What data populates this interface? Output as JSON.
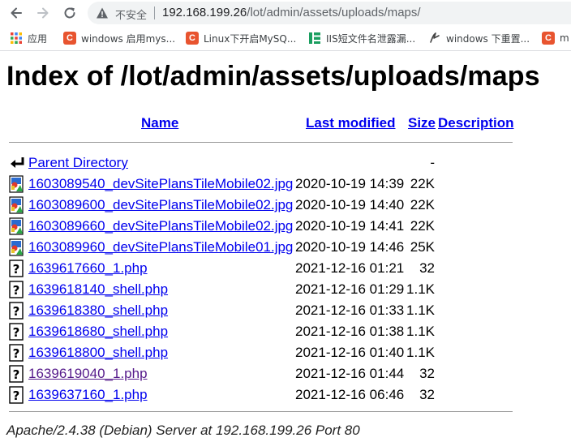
{
  "browser": {
    "security_label": "不安全",
    "url_host": "192.168.199.26",
    "url_path": "/lot/admin/assets/uploads/maps/"
  },
  "bookmarks": [
    {
      "label": "应用",
      "icon": "apps-grid-icon"
    },
    {
      "label": "windows 启用mys...",
      "icon": "csdn-icon"
    },
    {
      "label": "Linux下开启MySQ...",
      "icon": "csdn-icon"
    },
    {
      "label": "IIS短文件名泄露漏...",
      "icon": "page-icon"
    },
    {
      "label": "windows 下重置...",
      "icon": "link-icon"
    },
    {
      "label": "m",
      "icon": "csdn-icon"
    }
  ],
  "page": {
    "title": "Index of /lot/admin/assets/uploads/maps",
    "columns": {
      "name": "Name",
      "last_modified": "Last modified",
      "size": "Size",
      "description": "Description"
    },
    "parent": {
      "name": "Parent Directory",
      "size": "-",
      "icon": "back-arrow-icon"
    },
    "files": [
      {
        "name": "1603089540_devSitePlansTileMobile02.jpg",
        "modified": "2020-10-19 14:39",
        "size": "22K",
        "type": "image",
        "visited": false
      },
      {
        "name": "1603089600_devSitePlansTileMobile02.jpg",
        "modified": "2020-10-19 14:40",
        "size": "22K",
        "type": "image",
        "visited": false
      },
      {
        "name": "1603089660_devSitePlansTileMobile02.jpg",
        "modified": "2020-10-19 14:41",
        "size": "22K",
        "type": "image",
        "visited": false
      },
      {
        "name": "1603089960_devSitePlansTileMobile01.jpg",
        "modified": "2020-10-19 14:46",
        "size": "25K",
        "type": "image",
        "visited": false
      },
      {
        "name": "1639617660_1.php",
        "modified": "2021-12-16 01:21",
        "size": "32",
        "type": "unknown",
        "visited": false
      },
      {
        "name": "1639618140_shell.php",
        "modified": "2021-12-16 01:29",
        "size": "1.1K",
        "type": "unknown",
        "visited": false
      },
      {
        "name": "1639618380_shell.php",
        "modified": "2021-12-16 01:33",
        "size": "1.1K",
        "type": "unknown",
        "visited": false
      },
      {
        "name": "1639618680_shell.php",
        "modified": "2021-12-16 01:38",
        "size": "1.1K",
        "type": "unknown",
        "visited": false
      },
      {
        "name": "1639618800_shell.php",
        "modified": "2021-12-16 01:40",
        "size": "1.1K",
        "type": "unknown",
        "visited": false
      },
      {
        "name": "1639619040_1.php",
        "modified": "2021-12-16 01:44",
        "size": "32",
        "type": "unknown",
        "visited": true
      },
      {
        "name": "1639637160_1.php",
        "modified": "2021-12-16 06:46",
        "size": "32",
        "type": "unknown",
        "visited": false
      }
    ],
    "footer": "Apache/2.4.38 (Debian) Server at 192.168.199.26 Port 80"
  },
  "colors": {
    "link": "#0000ee",
    "visited_link": "#551a8b"
  }
}
